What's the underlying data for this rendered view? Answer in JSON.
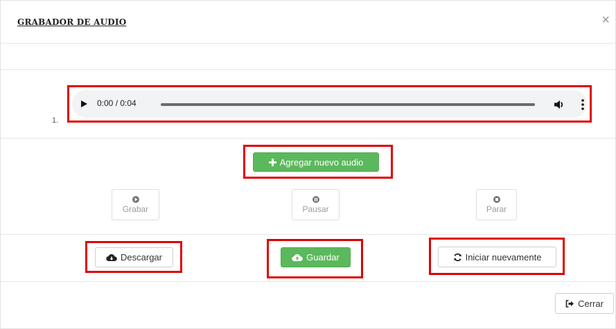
{
  "modal": {
    "title": "GRABADOR DE AUDIO",
    "close_symbol": "×"
  },
  "recordings": [
    {
      "number": "1.",
      "time": "0:00 / 0:04",
      "progress": 0.0
    }
  ],
  "buttons": {
    "add_audio": {
      "label": "Agregar nuevo audio",
      "icon": "plus-icon"
    },
    "record": {
      "label": "Grabar",
      "icon": "record-icon",
      "enabled": false
    },
    "pause": {
      "label": "Pausar",
      "icon": "pause-icon",
      "enabled": false
    },
    "stop": {
      "label": "Parar",
      "icon": "stop-icon",
      "enabled": false
    },
    "download": {
      "label": "Descargar",
      "icon": "cloud-download-icon"
    },
    "save": {
      "label": "Guardar",
      "icon": "cloud-upload-icon"
    },
    "restart": {
      "label": "Iniciar nuevamente",
      "icon": "refresh-icon"
    },
    "close": {
      "label": "Cerrar",
      "icon": "sign-out-icon"
    }
  },
  "colors": {
    "success": "#5cb85c",
    "highlight": "#e00000",
    "player_bg": "#f1f3f4"
  }
}
